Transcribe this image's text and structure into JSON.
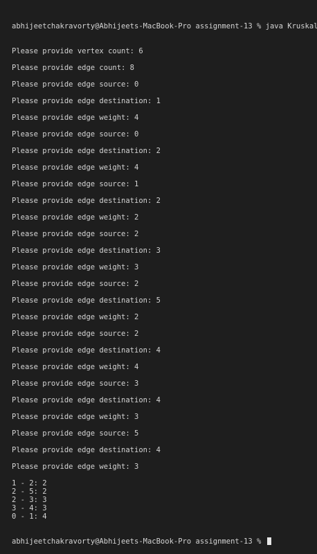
{
  "terminal": {
    "prompt_start": "abhijeetchakravorty@Abhijeets-MacBook-Pro assignment-13 % java Kruskal",
    "output": [
      "Please provide vertex count: 6",
      "",
      "Please provide edge count: 8",
      "",
      "Please provide edge source: 0",
      "",
      "Please provide edge destination: 1",
      "",
      "Please provide edge weight: 4",
      "",
      "Please provide edge source: 0",
      "",
      "Please provide edge destination: 2",
      "",
      "Please provide edge weight: 4",
      "",
      "Please provide edge source: 1",
      "",
      "Please provide edge destination: 2",
      "",
      "Please provide edge weight: 2",
      "",
      "Please provide edge source: 2",
      "",
      "Please provide edge destination: 3",
      "",
      "Please provide edge weight: 3",
      "",
      "Please provide edge source: 2",
      "",
      "Please provide edge destination: 5",
      "",
      "Please provide edge weight: 2",
      "",
      "Please provide edge source: 2",
      "",
      "Please provide edge destination: 4",
      "",
      "Please provide edge weight: 4",
      "",
      "Please provide edge source: 3",
      "",
      "Please provide edge destination: 4",
      "",
      "Please provide edge weight: 3",
      "",
      "Please provide edge source: 5",
      "",
      "Please provide edge destination: 4",
      "",
      "Please provide edge weight: 3",
      "",
      "1 - 2: 2",
      "2 - 5: 2",
      "2 - 3: 3",
      "3 - 4: 3",
      "0 - 1: 4"
    ],
    "prompt_end": "abhijeetchakravorty@Abhijeets-MacBook-Pro assignment-13 % "
  }
}
